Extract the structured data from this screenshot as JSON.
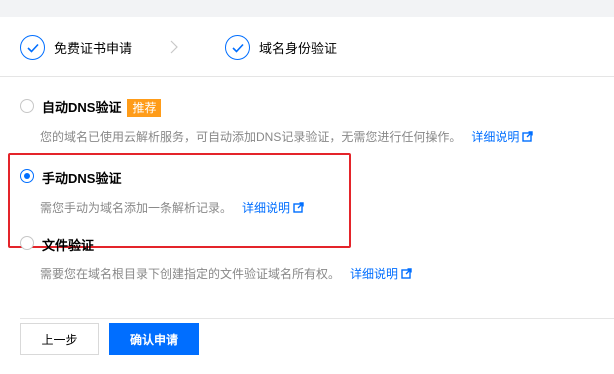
{
  "steps": [
    {
      "label": "免费证书申请",
      "status": "done"
    },
    {
      "label": "域名身份验证",
      "status": "current"
    }
  ],
  "options": [
    {
      "title": "自动DNS验证",
      "badge": "推荐",
      "desc": "您的域名已使用云解析服务，可自动添加DNS记录验证，无需您进行任何操作。",
      "link": "详细说明",
      "checked": false
    },
    {
      "title": "手动DNS验证",
      "desc": "需您手动为域名添加一条解析记录。",
      "link": "详细说明",
      "checked": true
    },
    {
      "title": "文件验证",
      "desc": "需要您在域名根目录下创建指定的文件验证域名所有权。",
      "link": "详细说明",
      "checked": false
    }
  ],
  "buttons": {
    "prev": "上一步",
    "confirm": "确认申请"
  },
  "colors": {
    "accent": "#006eff",
    "badge": "#ff9c19",
    "highlight": "#e4242a"
  }
}
